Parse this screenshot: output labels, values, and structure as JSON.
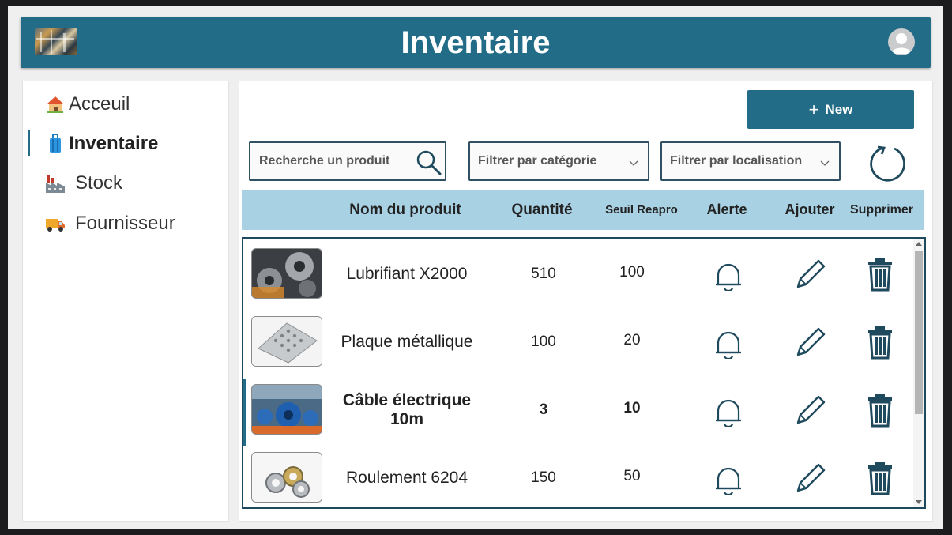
{
  "header": {
    "title": "Inventaire"
  },
  "sidebar": {
    "items": [
      {
        "label": "Acceuil",
        "icon": "house-icon",
        "active": false
      },
      {
        "label": "Inventaire",
        "icon": "luggage-icon",
        "active": true
      },
      {
        "label": "Stock",
        "icon": "factory-icon",
        "active": false
      },
      {
        "label": "Fournisseur",
        "icon": "delivery-truck-icon",
        "active": false
      }
    ]
  },
  "toolbar": {
    "new_label": "New",
    "search_placeholder": "Recherche un produit",
    "category_filter": "Filtrer par catégorie",
    "location_filter": "Filtrer par localisation"
  },
  "table": {
    "columns": {
      "name": "Nom du produit",
      "quantity": "Quantité",
      "threshold": "Seuil Reapro",
      "alert": "Alerte",
      "add": "Ajouter",
      "delete": "Supprimer"
    },
    "rows": [
      {
        "name": "Lubrifiant X2000",
        "quantity": "510",
        "threshold": "100",
        "image": "gears-photo"
      },
      {
        "name": "Plaque métallique",
        "quantity": "100",
        "threshold": "20",
        "image": "perforated-metal-photo"
      },
      {
        "name": "Câble électrique 10m",
        "quantity": "3",
        "threshold": "10",
        "image": "cable-spools-photo",
        "selected": true
      },
      {
        "name": "Roulement 6204",
        "quantity": "150",
        "threshold": "50",
        "image": "bearings-photo"
      }
    ]
  },
  "colors": {
    "primary": "#226c87",
    "header_row": "#a9d1e4",
    "border": "#1f4a5e"
  }
}
